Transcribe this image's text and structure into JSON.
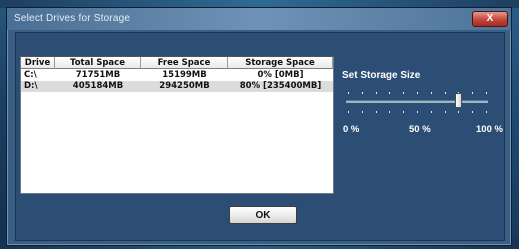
{
  "window": {
    "title": "Select Drives for Storage",
    "close_label": "X"
  },
  "drive_table": {
    "columns": [
      "Drive",
      "Total Space",
      "Free Space",
      "Storage Space"
    ],
    "rows": [
      {
        "drive": "C:\\",
        "total": "71751MB",
        "free": "15199MB",
        "storage": "0% [0MB]"
      },
      {
        "drive": "D:\\",
        "total": "405184MB",
        "free": "294250MB",
        "storage": "80% [235400MB]"
      }
    ]
  },
  "storage_slider": {
    "label": "Set Storage Size",
    "value_percent": 80,
    "tick_labels": [
      "0 %",
      "50 %",
      "100 %"
    ]
  },
  "ok_button": {
    "label": "OK"
  },
  "colors": {
    "client_background": "#2c4e74",
    "titlebar": "#6f93b6",
    "close_button": "#c6453a"
  }
}
